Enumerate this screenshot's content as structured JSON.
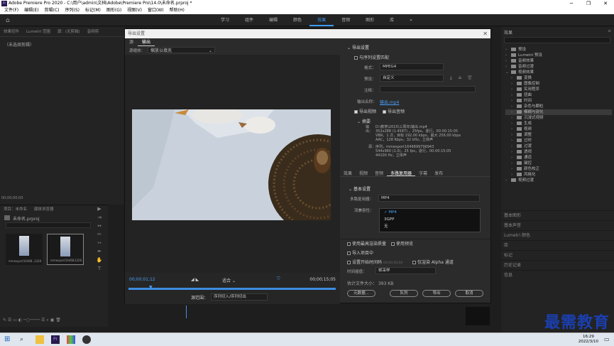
{
  "app": {
    "window_title": "Adobe Premiere Pro 2020 - C:\\用户\\admin\\文档\\Adobe\\Premiere Pro\\14.0\\未命名.prproj *",
    "menus": [
      "文件(F)",
      "编辑(E)",
      "剪辑(C)",
      "序列(S)",
      "标记(M)",
      "图形(G)",
      "视图(V)",
      "窗口(W)",
      "帮助(H)"
    ],
    "workspaces": [
      "学习",
      "组件",
      "编辑",
      "颜色",
      "效果",
      "音频",
      "图形",
      "库"
    ],
    "active_workspace": "效果"
  },
  "left_panel": {
    "tabs": [
      "效果控件",
      "Lumetri 范围",
      "源：(无剪辑)",
      "音频剪"
    ],
    "empty_text": "（未选择剪辑）",
    "timecode": "00;00;00;00"
  },
  "project": {
    "tabs": [
      "项目：未命名",
      "媒体浏览器"
    ],
    "name": "未命名.prproj",
    "clips": [
      {
        "name": "mmexport16468...",
        "duration": "1328"
      },
      {
        "name": "mmexport16468...",
        "duration": "1328"
      }
    ]
  },
  "right_panel": {
    "title": "效果",
    "effects": [
      {
        "label": "预设",
        "expanded": false
      },
      {
        "label": "Lumetri 预设",
        "expanded": false
      },
      {
        "label": "音频效果",
        "expanded": false
      },
      {
        "label": "音频过渡",
        "expanded": false
      },
      {
        "label": "视频效果",
        "expanded": true
      },
      {
        "label": "变换",
        "expanded": false,
        "child": true
      },
      {
        "label": "图像控制",
        "expanded": false,
        "child": true
      },
      {
        "label": "实用程序",
        "expanded": false,
        "child": true
      },
      {
        "label": "扭曲",
        "expanded": false,
        "child": true
      },
      {
        "label": "时间",
        "expanded": false,
        "child": true
      },
      {
        "label": "杂色与颗粒",
        "expanded": false,
        "child": true
      },
      {
        "label": "模糊与锐化",
        "expanded": false,
        "child": true,
        "selected": true
      },
      {
        "label": "沉浸式视频",
        "expanded": false,
        "child": true
      },
      {
        "label": "生成",
        "expanded": false,
        "child": true
      },
      {
        "label": "视频",
        "expanded": false,
        "child": true
      },
      {
        "label": "调整",
        "expanded": false,
        "child": true
      },
      {
        "label": "过时",
        "expanded": false,
        "child": true
      },
      {
        "label": "过渡",
        "expanded": false,
        "child": true
      },
      {
        "label": "透视",
        "expanded": false,
        "child": true
      },
      {
        "label": "通道",
        "expanded": false,
        "child": true
      },
      {
        "label": "键控",
        "expanded": false,
        "child": true
      },
      {
        "label": "颜色校正",
        "expanded": false,
        "child": true
      },
      {
        "label": "风格化",
        "expanded": false,
        "child": true
      },
      {
        "label": "视频过渡",
        "expanded": false
      }
    ],
    "sections": [
      "基本图形",
      "基本声音",
      "Lumetri 颜色",
      "库",
      "标记",
      "历史记录",
      "信息"
    ]
  },
  "dialog": {
    "title": "导出设置",
    "close": "✕",
    "tabs": [
      "源",
      "输出"
    ],
    "active_tab": "输出",
    "source_scale_label": "源缩放：",
    "source_scale_value": "缩放以填充",
    "timecode_in": "00;00;01;12",
    "timecode_out": "00;00;15;05",
    "fit_value": "适合",
    "source_range_label": "源范围：",
    "source_range_value": "序列切入/序列切出",
    "export_settings": {
      "header": "导出设置",
      "match_sequence": "与序列设置匹配",
      "format_label": "格式：",
      "format_value": "MPEG4",
      "preset_label": "预设：",
      "preset_value": "自定义",
      "comments_label": "注释：",
      "output_name_label": "输出名称：",
      "output_name_value": "输出.mp4",
      "export_video": "导出视频",
      "export_audio": "导出音频",
      "summary_header": "摘要",
      "summary_output_label": "输出：",
      "summary_output": [
        "D:\\教育\\2015\\三周年\\输出.mp4",
        "352x288 (1.4587) ，25fps，逐行，00:00:15:05",
        "VBR，1 次，目标 192.00 kbps，最大 256.00 kbps",
        "AAC，128 Kbps，32 kHz，立体声"
      ],
      "summary_source_label": "源：",
      "summary_source": [
        "序列，mmexport1646899796943",
        "544x960 (1.0)，25 fps，逐行，00:00:15:05",
        "44100 Hz，立体声"
      ]
    },
    "settings_tabs": [
      "效果",
      "视频",
      "音频",
      "多路复用器",
      "字幕",
      "发布"
    ],
    "active_settings_tab": "多路复用器",
    "basic_settings": {
      "header": "基本设置",
      "multiplexer_label": "多路复用器：",
      "multiplexer_value": "MP4",
      "stream_label": "流兼容性：",
      "options": [
        "MP4",
        "3GPP",
        "无"
      ],
      "selected_option": "MP4"
    },
    "bottom": {
      "max_render": "使用最高渲染质量",
      "use_previews": "使用预览",
      "import_project": "导入项目中",
      "set_start_tc": "设置开始时间码",
      "start_tc_value": "00;00;00;00",
      "render_alpha": "仅渲染 Alpha 通道",
      "interp_label": "时间插值：",
      "interp_value": "帧采样",
      "file_size_label": "估计文件大小：",
      "file_size_value": "393 KB",
      "btn_metadata": "元数据...",
      "btn_queue": "队列",
      "btn_export": "导出",
      "btn_cancel": "取消"
    }
  },
  "clock": {
    "time": "16:29",
    "date": "2022/3/10"
  },
  "watermark": "最需教育"
}
